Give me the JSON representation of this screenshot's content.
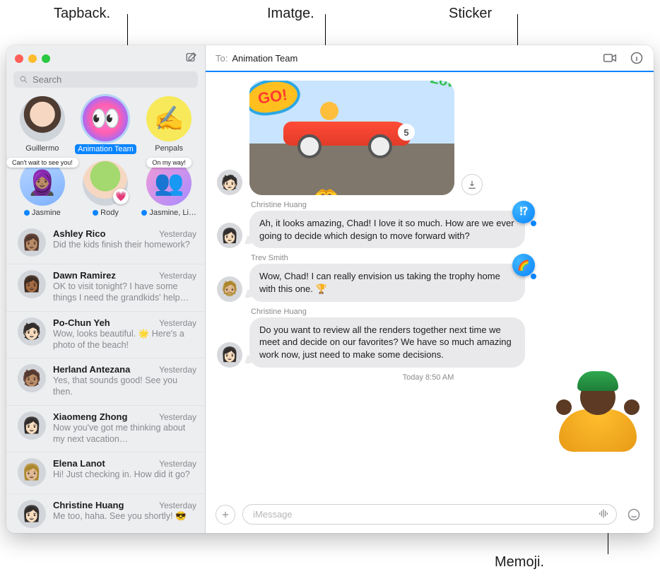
{
  "callouts": {
    "tapback": "Tapback.",
    "image": "Imatge.",
    "sticker": "Sticker",
    "memoji": "Memoji."
  },
  "sidebar": {
    "search_placeholder": "Search",
    "pins": [
      {
        "name": "Guillermo",
        "unread": false,
        "tag": null,
        "sel": false
      },
      {
        "name": "Animation Team",
        "unread": false,
        "tag": null,
        "sel": true
      },
      {
        "name": "Penpals",
        "unread": false,
        "tag": null,
        "sel": false
      },
      {
        "name": "Jasmine",
        "unread": true,
        "tag": "Can't wait to see you!",
        "sel": false
      },
      {
        "name": "Rody",
        "unread": true,
        "tag": null,
        "heart": true,
        "sel": false
      },
      {
        "name": "Jasmine, Li…",
        "unread": true,
        "tag": "On my way!",
        "sel": false
      }
    ],
    "conversations": [
      {
        "name": "Ashley Rico",
        "time": "Yesterday",
        "preview": "Did the kids finish their homework?"
      },
      {
        "name": "Dawn Ramirez",
        "time": "Yesterday",
        "preview": "OK to visit tonight? I have some things I need the grandkids' help with. 🥰"
      },
      {
        "name": "Po-Chun Yeh",
        "time": "Yesterday",
        "preview": "Wow, looks beautiful. 🌟 Here's a photo of the beach!"
      },
      {
        "name": "Herland Antezana",
        "time": "Yesterday",
        "preview": "Yes, that sounds good! See you then."
      },
      {
        "name": "Xiaomeng Zhong",
        "time": "Yesterday",
        "preview": "Now you've got me thinking about my next vacation…"
      },
      {
        "name": "Elena Lanot",
        "time": "Yesterday",
        "preview": "Hi! Just checking in. How did it go?"
      },
      {
        "name": "Christine Huang",
        "time": "Yesterday",
        "preview": "Me too, haha. See you shortly! 😎"
      }
    ]
  },
  "header": {
    "to_label": "To:",
    "recipient": "Animation Team"
  },
  "thread": {
    "image_go": "GO!",
    "image_zow": "Zow",
    "msg1_sender": "Christine Huang",
    "msg1_text": "Ah, it looks amazing, Chad! I love it so much. How are we ever going to decide which design to move forward with?",
    "msg1_tapback": "⁉",
    "msg2_sender": "Trev Smith",
    "msg2_text": "Wow, Chad! I can really envision us taking the trophy home with this one. 🏆",
    "msg2_tapback": "🌈",
    "msg3_sender": "Christine Huang",
    "msg3_text": "Do you want to review all the renders together next time we meet and decide on our favorites? We have so much amazing work now, just need to make some decisions.",
    "timestamp": "Today 8:50 AM"
  },
  "composer": {
    "placeholder": "iMessage"
  }
}
